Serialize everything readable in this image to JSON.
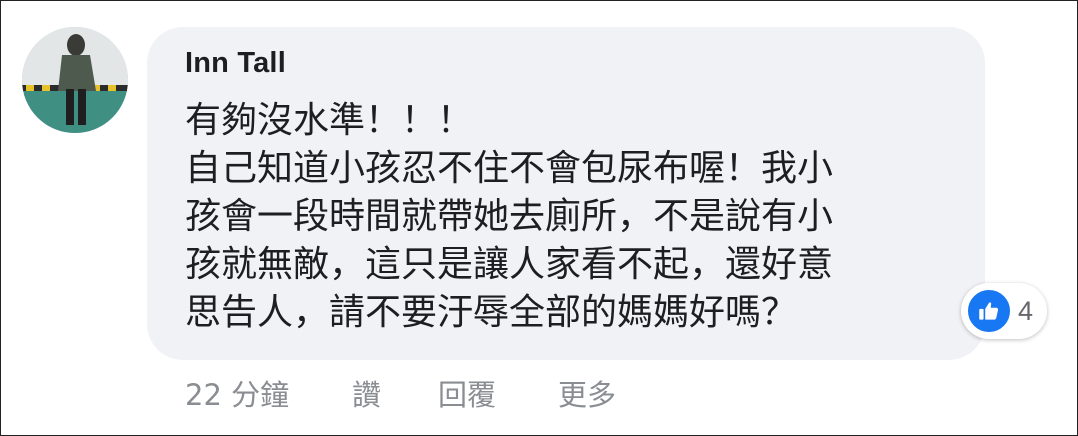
{
  "comment": {
    "author": "Inn Tall",
    "text_lines": [
      "有夠沒水準！！！",
      "自己知道小孩忍不住不會包尿布喔！我小",
      "孩會一段時間就帶她去廁所，不是說有小",
      "孩就無敵，這只是讓人家看不起，還好意",
      "思告人，請不要汙辱全部的媽媽好嗎？"
    ],
    "reaction": {
      "icon": "thumbs-up-icon",
      "count": "4",
      "color": "#1877f2"
    },
    "actions": {
      "timestamp": "22 分鐘",
      "like": "讚",
      "reply": "回覆",
      "more": "更多"
    }
  },
  "colors": {
    "bubble": "#f0f2f5",
    "text": "#1c1e21",
    "secondary_text": "#8a8d91"
  }
}
